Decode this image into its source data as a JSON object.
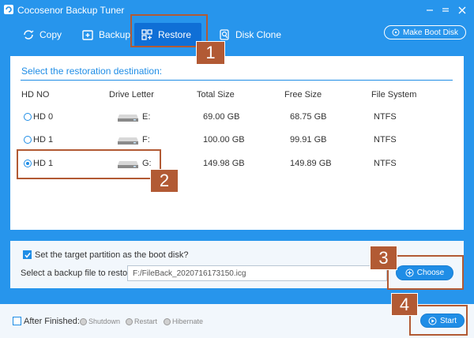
{
  "app": {
    "title": "Cocosenor Backup Tuner"
  },
  "toolbar": {
    "copy": "Copy",
    "backup": "Backup",
    "restore": "Restore",
    "disk_clone": "Disk Clone",
    "make_boot_disk": "Make Boot Disk"
  },
  "section": {
    "title": "Select the restoration destination:"
  },
  "table": {
    "headers": [
      "HD NO",
      "Drive Letter",
      "Total Size",
      "Free Size",
      "File System"
    ],
    "rows": [
      {
        "hd": "HD 0",
        "letter": "E:",
        "total": "69.00 GB",
        "free": "68.75 GB",
        "fs": "NTFS",
        "selected": false
      },
      {
        "hd": "HD 1",
        "letter": "F:",
        "total": "100.00 GB",
        "free": "99.91 GB",
        "fs": "NTFS",
        "selected": false
      },
      {
        "hd": "HD 1",
        "letter": "G:",
        "total": "149.98 GB",
        "free": "149.89 GB",
        "fs": "NTFS",
        "selected": true
      }
    ]
  },
  "options": {
    "boot_disk_label": "Set the target partition as the boot disk?",
    "backup_file_label": "Select a backup file to restore:",
    "backup_file_value": "F:/FileBack_2020716173150.icg",
    "choose_label": "Choose"
  },
  "footer": {
    "after_finished": "After Finished:",
    "shutdown": "Shutdown",
    "restart": "Restart",
    "hibernate": "Hibernate",
    "start": "Start"
  },
  "annotations": [
    "1",
    "2",
    "3",
    "4"
  ],
  "colors": {
    "accent": "#1f8de6",
    "annotation": "#b25a34"
  }
}
